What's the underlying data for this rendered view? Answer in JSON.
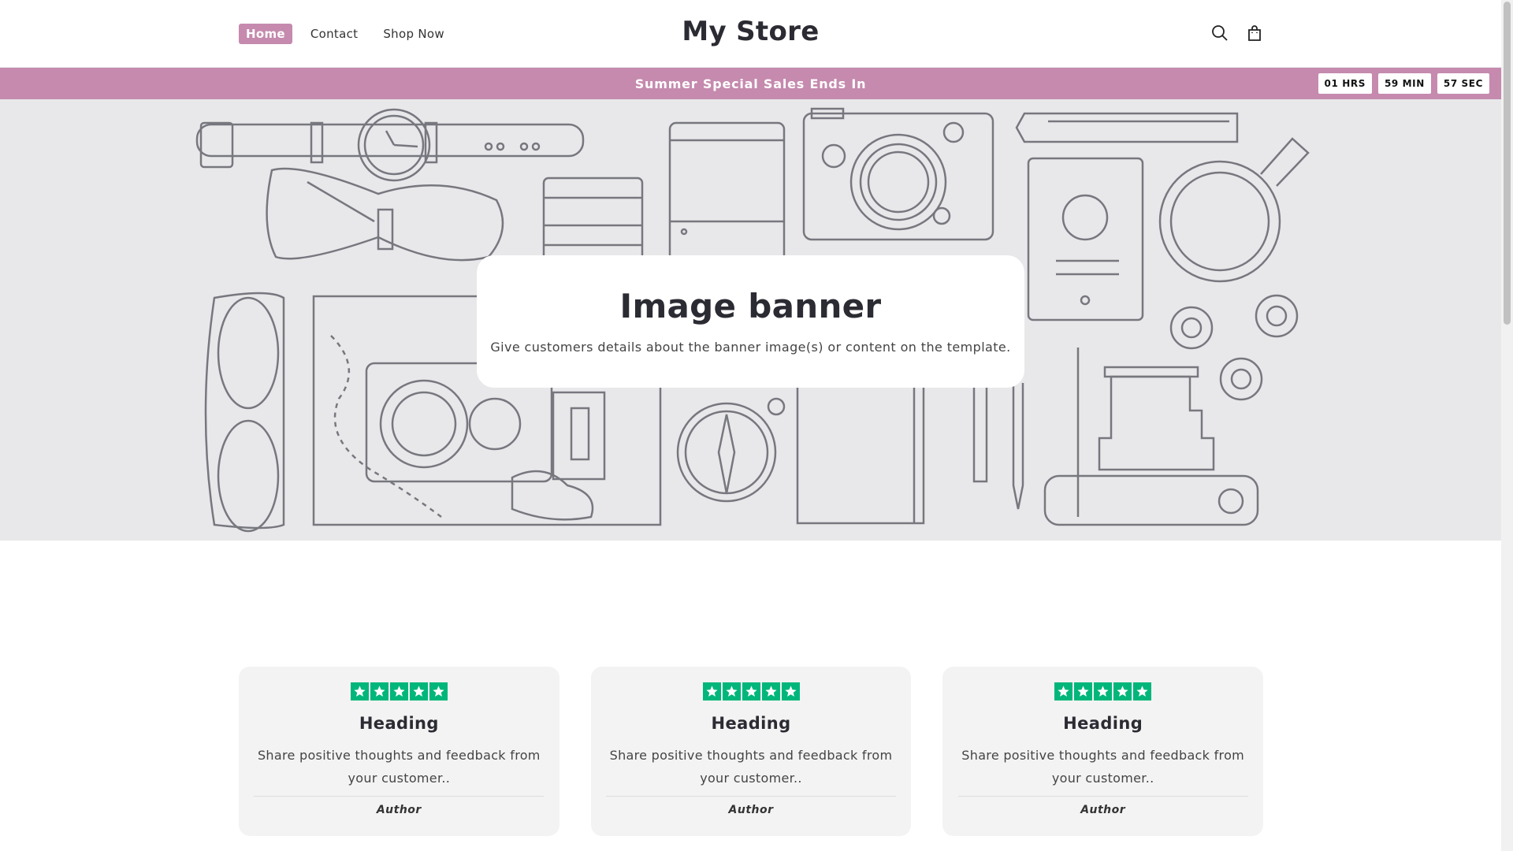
{
  "nav": {
    "items": [
      {
        "label": "Home",
        "active": true
      },
      {
        "label": "Contact",
        "active": false
      },
      {
        "label": "Shop Now",
        "active": false
      }
    ]
  },
  "header": {
    "store_name": "My Store",
    "icons": [
      "search-icon",
      "cart-icon"
    ]
  },
  "announcement": {
    "text": "Summer Special Sales Ends In",
    "countdown": {
      "hours": "01 HRS",
      "minutes": "59 MIN",
      "seconds": "57 SEC"
    }
  },
  "banner": {
    "title": "Image banner",
    "subtitle": "Give customers details about the banner image(s) or content on the template."
  },
  "testimonials": [
    {
      "rating": 5,
      "heading": "Heading",
      "body": "Share positive thoughts and feedback from your customer..",
      "author": "Author"
    },
    {
      "rating": 5,
      "heading": "Heading",
      "body": "Share positive thoughts and feedback from your customer..",
      "author": "Author"
    },
    {
      "rating": 5,
      "heading": "Heading",
      "body": "Share positive thoughts and feedback from your customer..",
      "author": "Author"
    }
  ],
  "colors": {
    "accent": "#c58aae",
    "star_green": "#00b67a",
    "hero_bg": "#e8e8ea",
    "illustration_stroke": "#77777f"
  }
}
